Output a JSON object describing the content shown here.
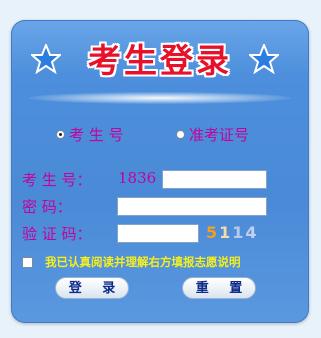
{
  "header": {
    "title": "考生登录"
  },
  "login_type": {
    "options": [
      {
        "label": "考 生 号",
        "selected": true
      },
      {
        "label": "准考证号",
        "selected": false
      }
    ]
  },
  "fields": {
    "candidate_label": "考 生 号：",
    "candidate_prefix": "1836",
    "candidate_value": "",
    "password_label": "密    码：",
    "password_value": "",
    "captcha_label": "验 证 码：",
    "captcha_value": "",
    "captcha_image": [
      "5",
      "1",
      "1",
      "4"
    ]
  },
  "agreement": {
    "checked": false,
    "text": "我已认真阅读并理解右方填报志愿说明"
  },
  "buttons": {
    "login": "登 录",
    "reset": "重 置"
  },
  "colors": {
    "panel_blue": "#4d8fdc",
    "title_red": "#e8112a",
    "label_magenta": "#c4029e",
    "agree_yellow": "#f5ef1e",
    "button_text": "#0e2a8a"
  }
}
